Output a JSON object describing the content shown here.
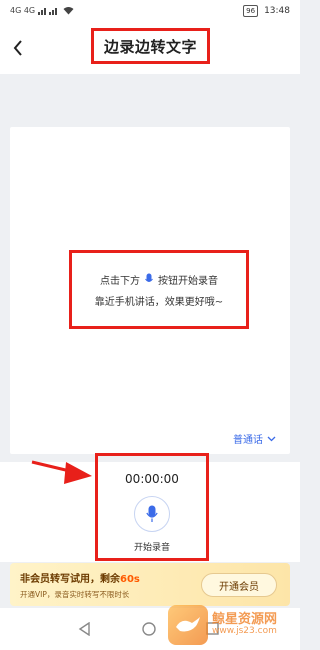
{
  "status_bar": {
    "time": "13:48",
    "battery": "96",
    "signal_text": "4G 4G"
  },
  "header": {
    "title": "边录边转文字"
  },
  "hint": {
    "line1_pre": "点击下方",
    "line1_post": "按钮开始录音",
    "line2": "靠近手机讲话，效果更好哦~"
  },
  "mode": {
    "selected": "普通话"
  },
  "recorder": {
    "timer": "00:00:00",
    "label": "开始录音"
  },
  "promo": {
    "title_pre": "非会员转写试用，剩余",
    "remaining": "60s",
    "subtitle": "开通VIP，录音实时转写不限时长",
    "button": "开通会员"
  },
  "watermark": {
    "name": "鲸星资源网",
    "url": "www.js23.com"
  },
  "colors": {
    "accent": "#3b6be8",
    "highlight": "#e8201a",
    "promo_orange": "#ff5a00"
  }
}
